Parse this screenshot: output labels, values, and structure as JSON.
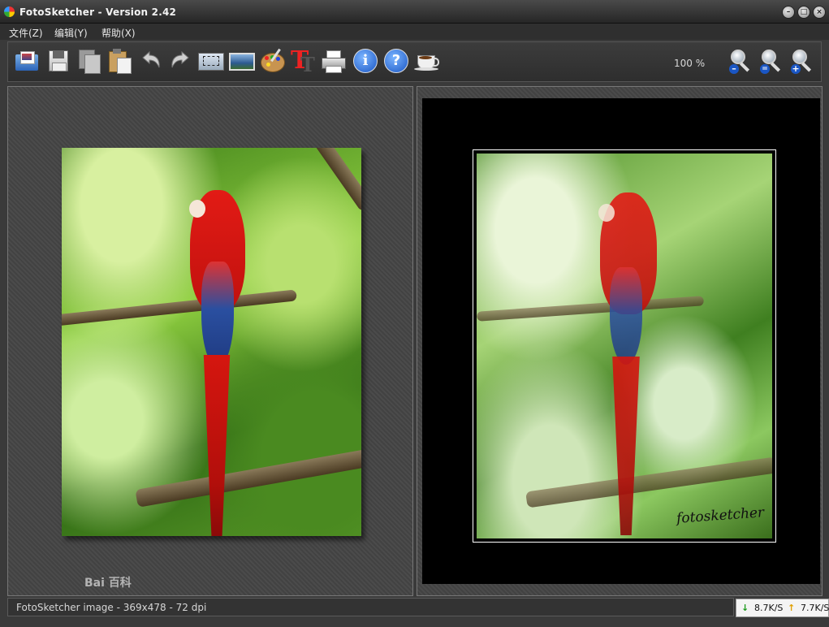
{
  "window": {
    "title": "FotoSketcher - Version 2.42"
  },
  "menu": {
    "items": [
      "文件(Z)",
      "编辑(Y)",
      "帮助(X)"
    ]
  },
  "toolbar": {
    "buttons": [
      "open-folder-icon",
      "save-disk-icon",
      "copy-icon",
      "paste-icon",
      "undo-icon",
      "redo-icon",
      "crop-image-icon",
      "resize-image-icon",
      "paint-palette-icon",
      "add-text-icon",
      "print-icon",
      "info-icon",
      "help-icon",
      "coffee-cup-icon"
    ],
    "zoom_level": "100 %",
    "zoom_buttons": [
      "zoom-out-icon",
      "zoom-actual-icon",
      "zoom-in-icon"
    ]
  },
  "original_panel": {
    "watermark": "Bai 百科"
  },
  "result_panel": {
    "signature": "fotosketcher"
  },
  "status": {
    "text": "FotoSketcher image - 369x478 - 72 dpi"
  },
  "netmeter": {
    "download": "8.7K/S",
    "upload": "7.7K/S"
  },
  "colors": {
    "download_arrow": "#1a9a1a",
    "upload_arrow": "#e0a000",
    "parrot_red": "#d5160f",
    "foliage_green": "#5a9a28"
  }
}
